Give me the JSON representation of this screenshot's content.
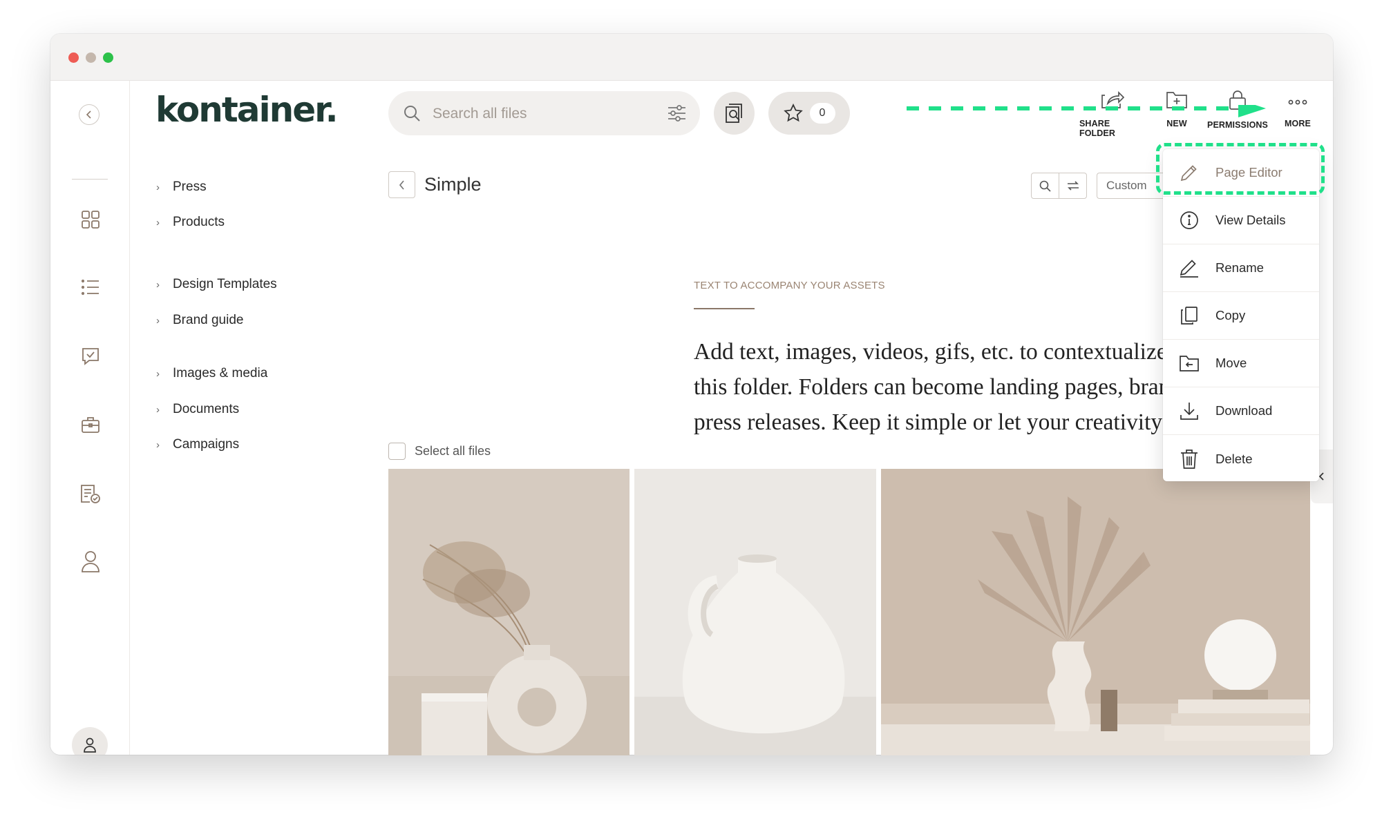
{
  "window": {
    "traffic_lights": [
      "#ee5c55",
      "#c4b7ac",
      "#2cc14a"
    ]
  },
  "rail": {
    "icons": [
      "back-icon",
      "grid-icon",
      "list-icon",
      "chat-check-icon",
      "briefcase-icon",
      "checklist-icon",
      "user-icon",
      "account-avatar-icon"
    ]
  },
  "brand": {
    "logo": "kontainer."
  },
  "nav": {
    "items": [
      {
        "label": "Press"
      },
      {
        "label": "Products"
      },
      {
        "label": "Design Templates"
      },
      {
        "label": "Brand guide"
      },
      {
        "label": "Images & media"
      },
      {
        "label": "Documents"
      },
      {
        "label": "Campaigns"
      }
    ]
  },
  "search": {
    "placeholder": "Search all files"
  },
  "favorites": {
    "count": "0"
  },
  "toolbar": {
    "share_folder": "SHARE FOLDER",
    "new": "NEW",
    "permissions": "PERMISSIONS",
    "more": "MORE"
  },
  "folder": {
    "title": "Simple",
    "sort_label": "Custom",
    "kicker": "TEXT TO ACCOMPANY YOUR ASSETS",
    "body_lines": [
      "Add text, images, videos, gifs, etc. to contextualize",
      "this folder. Folders can become landing pages, brand",
      "press releases. Keep it simple or let your creativity"
    ],
    "select_all": "Select all files"
  },
  "menu": {
    "items": [
      {
        "label": "Page Editor",
        "icon": "pencil-icon"
      },
      {
        "label": "View Details",
        "icon": "info-icon"
      },
      {
        "label": "Rename",
        "icon": "rename-icon"
      },
      {
        "label": "Copy",
        "icon": "copy-icon"
      },
      {
        "label": "Move",
        "icon": "move-folder-icon"
      },
      {
        "label": "Download",
        "icon": "download-icon"
      },
      {
        "label": "Delete",
        "icon": "trash-icon"
      }
    ]
  },
  "colors": {
    "accent_annotation": "#20e08a",
    "brand_dark": "#1f3a34",
    "muted_brown": "#8a7768"
  }
}
